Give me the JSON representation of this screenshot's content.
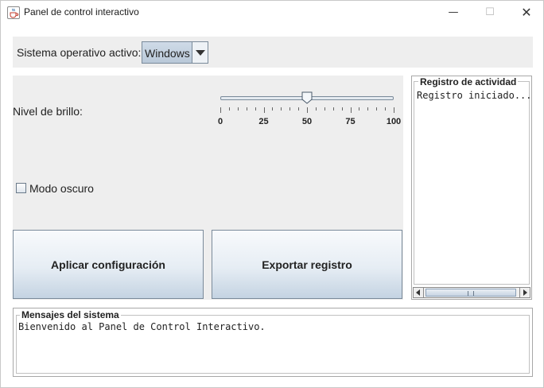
{
  "window": {
    "title": "Panel de control interactivo",
    "controls": {
      "minimize": "—",
      "maximize": "☐",
      "close": "✕"
    }
  },
  "os_selector": {
    "label": "Sistema operativo activo:",
    "selected": "Windows"
  },
  "brightness": {
    "label": "Nivel de brillo:",
    "value": 50,
    "min": 0,
    "max": 100,
    "major_tick_labels": [
      "0",
      "25",
      "50",
      "75",
      "100"
    ],
    "minor_tick_step": 5
  },
  "dark_mode": {
    "label": "Modo oscuro",
    "checked": false
  },
  "buttons": {
    "apply_label": "Aplicar configuración",
    "export_label": "Exportar registro"
  },
  "activity_log": {
    "title": "Registro de actividad",
    "text": "Registro iniciado..."
  },
  "system_messages": {
    "title": "Mensajes del sistema",
    "text": "Bienvenido al Panel de Control Interactivo."
  },
  "colors": {
    "window_bg": "#ffffff",
    "panel_bg": "#eeeeee",
    "button_gradient_bottom": "#c4d3e2",
    "combo_bg": "#b9c8d8"
  },
  "icons": {
    "app": "java-coffee-cup-icon",
    "combo_arrow": "triangle-down-icon",
    "slider_thumb": "slider-pointer-icon",
    "scroll_left": "arrow-left-icon",
    "scroll_right": "arrow-right-icon"
  }
}
